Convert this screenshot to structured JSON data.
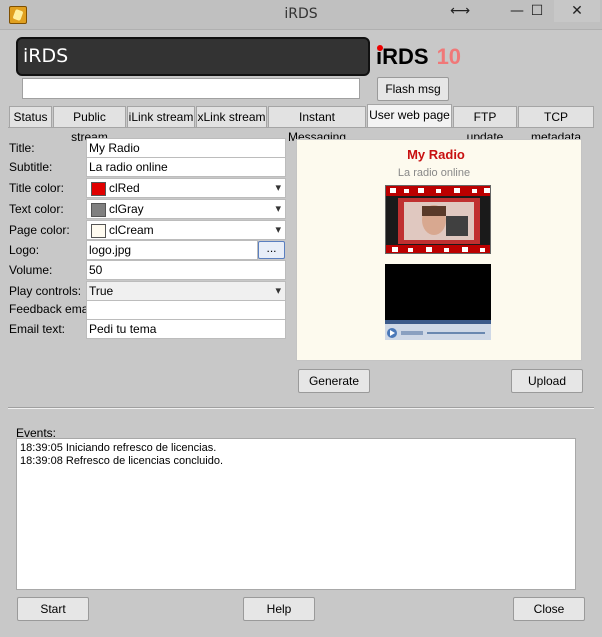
{
  "window": {
    "title": "iRDS",
    "resize_icon": "⟷",
    "min_icon": "—",
    "max_icon": "☐",
    "close_icon": "✕"
  },
  "header": {
    "display_text": "iRDS",
    "brand_name": "iRDS",
    "brand_version": "10",
    "flash_input_value": "",
    "flash_button": "Flash msg"
  },
  "tabs": [
    {
      "label": "Status",
      "active": false
    },
    {
      "label": "Public stream",
      "active": false
    },
    {
      "label": "iLink stream",
      "active": false
    },
    {
      "label": "xLink stream",
      "active": false
    },
    {
      "label": "Instant Messaging",
      "active": false
    },
    {
      "label": "User web page",
      "active": true
    },
    {
      "label": "FTP update",
      "active": false
    },
    {
      "label": "TCP metadata",
      "active": false
    }
  ],
  "form": {
    "title_label": "Title:",
    "title_value": "My Radio",
    "subtitle_label": "Subtitle:",
    "subtitle_value": "La radio online",
    "title_color_label": "Title color:",
    "title_color_value": "clRed",
    "title_color_swatch": "#e00000",
    "text_color_label": "Text color:",
    "text_color_value": "clGray",
    "text_color_swatch": "#808080",
    "page_color_label": "Page color:",
    "page_color_value": "clCream",
    "page_color_swatch": "#fffbf0",
    "logo_label": "Logo:",
    "logo_value": "logo.jpg",
    "logo_browse": "...",
    "volume_label": "Volume:",
    "volume_value": "50",
    "play_controls_label": "Play controls:",
    "play_controls_value": "True",
    "feedback_email_label": "Feedback email:",
    "feedback_email_value": "",
    "email_text_label": "Email text:",
    "email_text_value": "Pedi tu tema"
  },
  "preview": {
    "title": "My Radio",
    "subtitle": "La radio online",
    "generate_button": "Generate",
    "upload_button": "Upload"
  },
  "events": {
    "label": "Events:",
    "lines": [
      "18:39:05 Iniciando refresco de licencias.",
      "18:39:08 Refresco de licencias concluido."
    ]
  },
  "footer": {
    "start_button": "Start",
    "help_button": "Help",
    "close_button": "Close"
  }
}
